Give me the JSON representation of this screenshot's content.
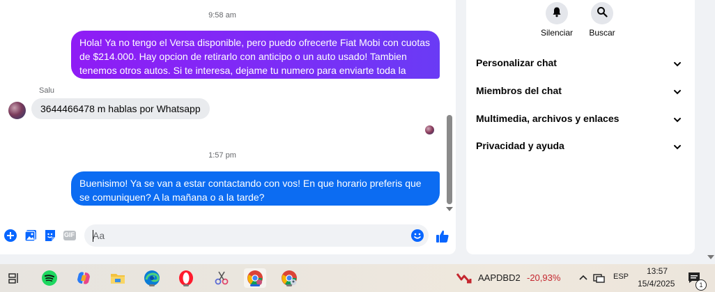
{
  "chat": {
    "timestamp_1": "9:58 am",
    "outgoing_1": "Hola! Ya no tengo el Versa disponible, pero puedo ofrecerte Fiat Mobi con cuotas de $214.000. Hay opcion de retirarlo con anticipo o un auto usado! Tambien tenemos otros autos. Si te interesa, dejame tu numero para enviarte toda la informacion",
    "sender_name": "Salu",
    "incoming_1": "3644466478 m hablas por Whatsapp",
    "timestamp_2": "1:57 pm",
    "outgoing_2": "Buenisimo! Ya se van a estar contactando con vos! En que horario preferis que se comuniquen? A la mañana o a la tarde?",
    "composer_placeholder": "Aa",
    "composer_icons": [
      "plus-circle-icon",
      "gallery-icon",
      "sticker-icon",
      "gif-icon",
      "emoji-icon",
      "thumbs-up-icon"
    ],
    "gif_label": "GIF"
  },
  "info_panel": {
    "actions": [
      {
        "label": "Silenciar",
        "icon": "bell-icon"
      },
      {
        "label": "Buscar",
        "icon": "search-icon"
      }
    ],
    "sections": [
      {
        "label": "Personalizar chat"
      },
      {
        "label": "Miembros del chat"
      },
      {
        "label": "Multimedia, archivos y enlaces"
      },
      {
        "label": "Privacidad y ayuda"
      }
    ]
  },
  "taskbar": {
    "apps": [
      "task-view-icon",
      "spotify-icon",
      "copilot-icon",
      "file-explorer-icon",
      "edge-icon",
      "opera-icon",
      "snipping-icon",
      "chrome-icon",
      "chrome-profile-icon"
    ],
    "stock_symbol": "AAPDBD2",
    "stock_change": "-20,93%",
    "language": "ESP",
    "time": "13:57",
    "date": "15/4/2025",
    "notification_count": "1"
  },
  "colors": {
    "outgoing_gradient_start": "#8f1cf5",
    "outgoing_gradient_end": "#6a3bf5",
    "outgoing_blue": "#0c6cf2",
    "incoming_bg": "#e9ebee",
    "accent": "#0866ff",
    "stock_negative": "#c4262e"
  }
}
